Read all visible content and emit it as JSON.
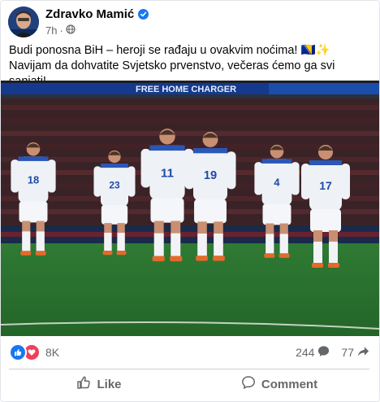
{
  "author": {
    "name": "Zdravko Mamić",
    "verified": true,
    "time": "7h",
    "visibility_icon": "globe-icon"
  },
  "post": {
    "text": "Budi ponosna BiH – heroji se rađaju u ovakvim noćima! 🇧🇦✨ Navijam da dohvatite Svjetsko prvenstvo, večeras ćemo ga svi sanjati!"
  },
  "photo": {
    "banner_text": "FREE HOME CHARGER",
    "shirt_numbers": [
      "18",
      "23",
      "11",
      "19",
      "4",
      "17"
    ]
  },
  "reactions": {
    "count": "8K",
    "types": [
      "like-icon",
      "love-icon"
    ],
    "comments": "244",
    "shares": "77"
  },
  "actions": {
    "like_label": "Like",
    "comment_label": "Comment"
  },
  "colors": {
    "brand_blue": "#1877f2",
    "love_red": "#f33e58",
    "meta_grey": "#65676b",
    "pitch_green": "#2f7a34",
    "kit_white": "#eef1f6"
  }
}
